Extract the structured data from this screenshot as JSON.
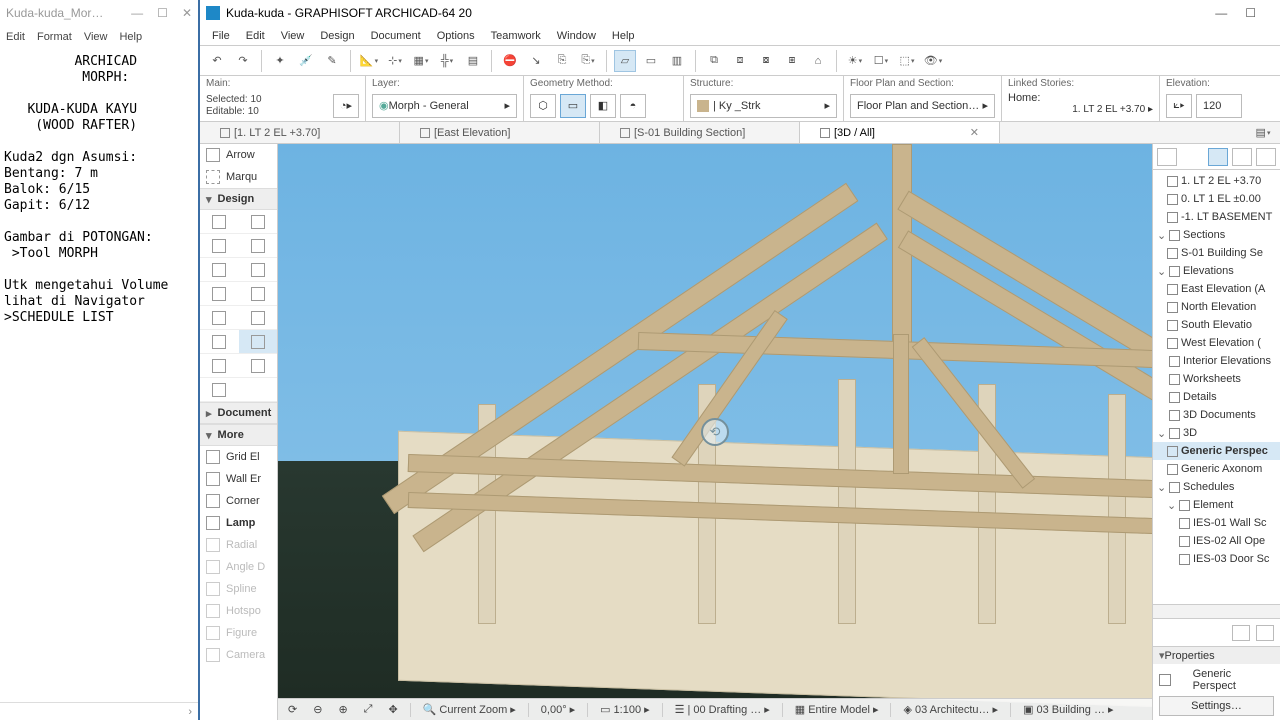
{
  "notepad": {
    "title": "Kuda-kuda_Mor…",
    "menu": [
      "Edit",
      "Format",
      "View",
      "Help"
    ],
    "body": "         ARCHICAD\n          MORPH:\n\n   KUDA-KUDA KAYU\n    (WOOD RAFTER)\n\nKuda2 dgn Asumsi:\nBentang: 7 m\nBalok: 6/15\nGapit: 6/12\n\nGambar di POTONGAN:\n >Tool MORPH\n\nUtk mengetahui Volume\nlihat di Navigator\n>SCHEDULE LIST",
    "scroll_hint": "›"
  },
  "ac": {
    "title": "Kuda-kuda - GRAPHISOFT ARCHICAD-64 20",
    "menu": [
      "File",
      "Edit",
      "View",
      "Design",
      "Document",
      "Options",
      "Teamwork",
      "Window",
      "Help"
    ],
    "info": {
      "main_label": "Main:",
      "selected": "Selected: 10",
      "editable": "Editable: 10",
      "layer_label": "Layer:",
      "layer_value": "Morph - General",
      "geom_label": "Geometry Method:",
      "struct_label": "Structure:",
      "struct_value": "| Ky _Strk",
      "fps_label": "Floor Plan and Section:",
      "fps_value": "Floor Plan and Section…",
      "linked_label": "Linked Stories:",
      "linked_value": "Home:",
      "linked_story": "1. LT 2 EL +3.70",
      "elev_label": "Elevation:",
      "elev_value": "120"
    },
    "tabs": [
      {
        "label": "[1. LT 2 EL +3.70]"
      },
      {
        "label": "[East Elevation]"
      },
      {
        "label": "[S-01 Building Section]"
      },
      {
        "label": "[3D / All]",
        "active": true
      }
    ],
    "toolbox": {
      "arrow": "Arrow",
      "marquee": "Marqu",
      "design": "Design",
      "document": "Document",
      "more": "More",
      "more_items": [
        "Grid El",
        "Wall Er",
        "Corner",
        "Lamp",
        "Radial",
        "Angle D",
        "Spline",
        "Hotspo",
        "Figure",
        "Camera"
      ]
    },
    "quickbar": {
      "zoom": "Current Zoom",
      "angle": "0,00°",
      "scale": "1:100",
      "layercomb": "| 00 Drafting …",
      "model": "Entire Model",
      "arch": "03 Architectu…",
      "bld": "03 Building …"
    },
    "nav": {
      "stories": [
        "1. LT 2 EL +3.70",
        "0. LT 1 EL ±0.00",
        "-1. LT BASEMENT"
      ],
      "sections_h": "Sections",
      "sections": [
        "S-01 Building Se"
      ],
      "elev_h": "Elevations",
      "elevs": [
        "East Elevation (A",
        "North Elevation",
        "South Elevatio",
        "West Elevation ("
      ],
      "int_elev": "Interior Elevations",
      "ws": "Worksheets",
      "details": "Details",
      "d3docs": "3D Documents",
      "d3": "3D",
      "d3_items": [
        "Generic Perspec",
        "Generic Axonom"
      ],
      "sched": "Schedules",
      "sched_el": "Element",
      "sched_items": [
        "IES-01 Wall Sc",
        "IES-02 All Ope",
        "IES-03 Door Sc"
      ],
      "prop_h": "Properties",
      "prop_val": "Generic Perspect",
      "settings": "Settings…"
    }
  }
}
